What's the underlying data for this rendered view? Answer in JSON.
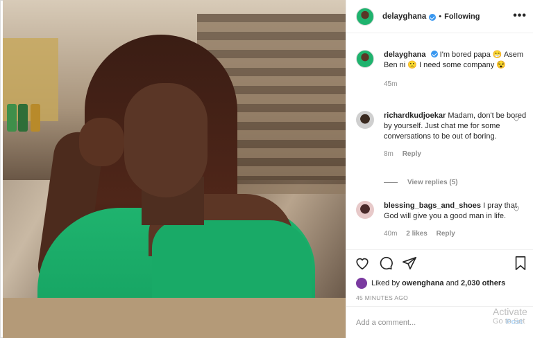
{
  "post": {
    "author": "delayghana",
    "follow_status": "Following",
    "more_label": "•••",
    "caption": {
      "username": "delayghana",
      "text": "I'm bored papa 😁 Asem Ben ni 🙁 I need some company 😵",
      "time": "45m"
    }
  },
  "comments": [
    {
      "username": "richardkudjoekar",
      "text": "Madam, don't be bored by yourself. Just chat me for some conversations to be out of boring.",
      "time": "8m",
      "reply_label": "Reply",
      "view_replies": "View replies (5)"
    },
    {
      "username": "blessing_bags_and_shoes",
      "text": "I pray that God will give you a good man in life.",
      "time": "40m",
      "likes": "2 likes",
      "reply_label": "Reply"
    }
  ],
  "likes": {
    "prefix": "Liked by",
    "user": "owenghana",
    "connector": "and",
    "others": "2,030 others"
  },
  "timestamp": "45 MINUTES AGO",
  "add_comment": {
    "placeholder": "Add a comment...",
    "post_label": "Post"
  },
  "watermark": {
    "line1": "Activate",
    "line2": "Go to Set"
  },
  "icons": {
    "like": "heart-icon",
    "comment": "comment-icon",
    "share": "share-icon",
    "save": "bookmark-icon",
    "verified": "verified-icon",
    "more": "more-icon"
  }
}
